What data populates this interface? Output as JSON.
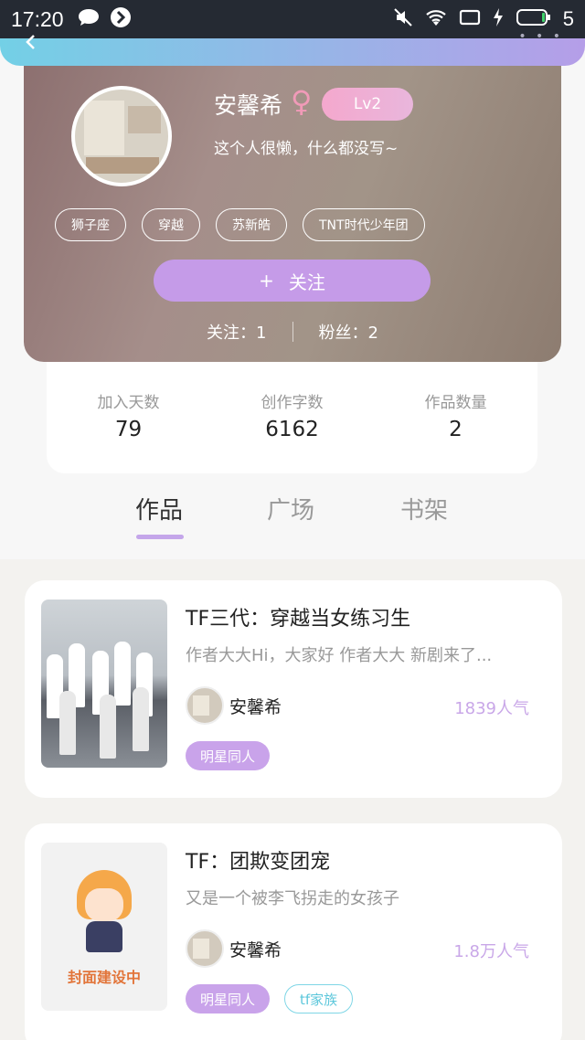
{
  "status_bar": {
    "time": "17:20",
    "battery": "5"
  },
  "profile": {
    "name": "安馨希",
    "gender_symbol": "♀",
    "level": "Lv2",
    "bio": "这个人很懒，什么都没写~",
    "tags": [
      "狮子座",
      "穿越",
      "苏新皓",
      "TNT时代少年团"
    ],
    "follow_button": "关注",
    "follow_plus": "+",
    "following_label": "关注：1",
    "fans_label": "粉丝：2"
  },
  "stats": [
    {
      "label": "加入天数",
      "value": "79"
    },
    {
      "label": "创作字数",
      "value": "6162"
    },
    {
      "label": "作品数量",
      "value": "2"
    }
  ],
  "tabs": [
    {
      "label": "作品",
      "active": true
    },
    {
      "label": "广场",
      "active": false
    },
    {
      "label": "书架",
      "active": false
    }
  ],
  "books": [
    {
      "title": "TF三代：穿越当女练习生",
      "desc": "作者大大Hi，大家好 作者大大 新剧来了...",
      "author": "安馨希",
      "popularity": "1839人气",
      "tags": [
        "明星同人"
      ]
    },
    {
      "title": "TF：团欺变团宠",
      "desc": "又是一个被李飞拐走的女孩子",
      "author": "安馨希",
      "popularity": "1.8万人气",
      "cover_text": "封面建设中",
      "tags": [
        "明星同人",
        "tf家族"
      ]
    }
  ],
  "colors": {
    "accent": "#c59be8",
    "level_badge": "#f4a8cd",
    "tag_outline": "#7fd6e6"
  }
}
